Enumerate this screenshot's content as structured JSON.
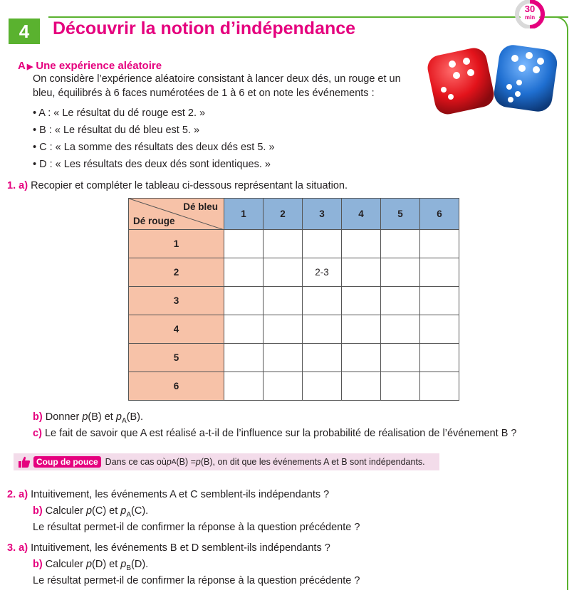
{
  "header": {
    "number": "4",
    "title": "Découvrir la notion d’indépendance",
    "timer_value": "30",
    "timer_unit": "min"
  },
  "section": {
    "letter": "A",
    "title": "Une expérience aléatoire"
  },
  "intro": [
    "On considère l’expérience aléatoire consistant à lancer deux dés, un rouge et un",
    "bleu, équilibrés à 6 faces numérotées de 1 à 6 et on note les événements :"
  ],
  "events": [
    "• A : « Le résultat du dé rouge est 2. »",
    "• B : « Le résultat du dé bleu est 5. »",
    "• C : « La somme des résultats des deux dés est 5. »",
    "• D : « Les résultats des deux dés sont identiques. »"
  ],
  "q1": {
    "num": "1.",
    "a_label": "a)",
    "a_text": "Recopier et compléter le tableau ci-dessous représentant la situation.",
    "b_label": "b)",
    "b_text_pre": "Donner ",
    "b_p": "p",
    "b_mid": "(B) et ",
    "b_p2": "p",
    "b_sub": "A",
    "b_post": "(B).",
    "c_label": "c)",
    "c_text": "Le fait de savoir que A est réalisé a-t-il de l’influence sur la probabilité de réalisation de l’événement B ?"
  },
  "table": {
    "corner_top": "Dé bleu",
    "corner_bottom": "Dé rouge",
    "columns": [
      "1",
      "2",
      "3",
      "4",
      "5",
      "6"
    ],
    "rows": [
      {
        "label": "1",
        "cells": [
          "",
          "",
          "",
          "",
          "",
          ""
        ]
      },
      {
        "label": "2",
        "cells": [
          "",
          "",
          "2-3",
          "",
          "",
          ""
        ]
      },
      {
        "label": "3",
        "cells": [
          "",
          "",
          "",
          "",
          "",
          ""
        ]
      },
      {
        "label": "4",
        "cells": [
          "",
          "",
          "",
          "",
          "",
          ""
        ]
      },
      {
        "label": "5",
        "cells": [
          "",
          "",
          "",
          "",
          "",
          ""
        ]
      },
      {
        "label": "6",
        "cells": [
          "",
          "",
          "",
          "",
          "",
          ""
        ]
      }
    ]
  },
  "hint": {
    "badge": "Coup de pouce",
    "pre": "Dans ce cas où ",
    "p1": "p",
    "sub": "A",
    "mid": "(B) = ",
    "p2": "p",
    "post": "(B), on dit que les événements A et B sont indépendants."
  },
  "q2": {
    "num": "2.",
    "a_label": "a)",
    "a_text": "Intuitivement, les événements A et C semblent-ils indépendants ?",
    "b_label": "b)",
    "b_pre": "Calculer ",
    "b_p": "p",
    "b_mid": "(C) et ",
    "b_p2": "p",
    "b_sub": "A",
    "b_post": "(C).",
    "c_text": "Le résultat permet-il de confirmer la réponse à la question précédente ?"
  },
  "q3": {
    "num": "3.",
    "a_label": "a)",
    "a_text": "Intuitivement, les événements B et D semblent-ils indépendants ?",
    "b_label": "b)",
    "b_pre": "Calculer ",
    "b_p": "p",
    "b_mid": "(D) et ",
    "b_p2": "p",
    "b_sub": "B",
    "b_post": "(D).",
    "c_text": "Le résultat permet-il de confirmer la réponse à la question précédente ?"
  },
  "colors": {
    "accent": "#e5007e",
    "green": "#5ab22f",
    "row_header": "#f7c2a8",
    "col_header": "#8eb3d9",
    "hint_bg": "#f3dcea"
  }
}
